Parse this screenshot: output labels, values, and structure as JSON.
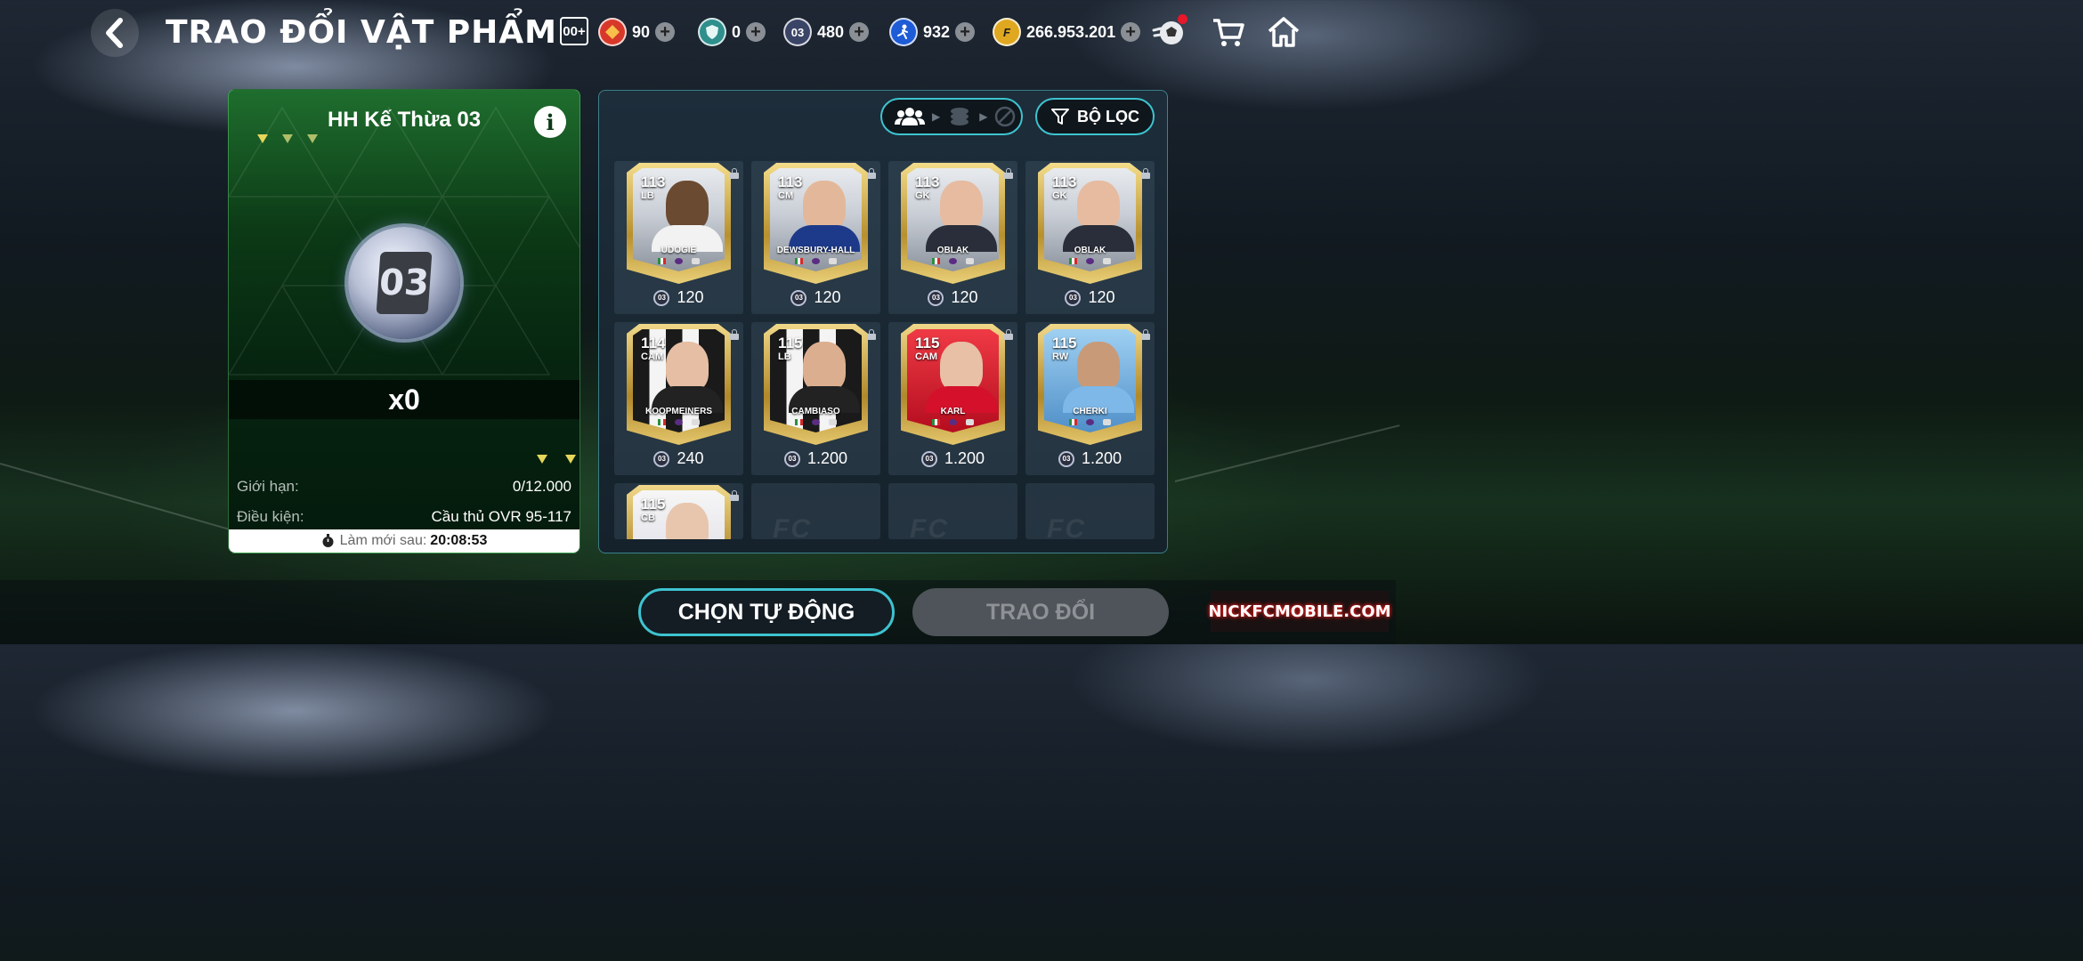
{
  "header": {
    "title": "TRAO ĐỔI VẬT PHẨM",
    "season_badge": "00+",
    "currencies": [
      {
        "name": "gem-red",
        "value": "90",
        "color": "#d8382a"
      },
      {
        "name": "shield",
        "value": "0",
        "color": "#2f8f8c"
      },
      {
        "name": "token-03",
        "value": "480",
        "icon_text": "03",
        "color": "#3a4466"
      },
      {
        "name": "player-icon",
        "value": "932",
        "color": "#1e5bd6"
      },
      {
        "name": "fc-coin",
        "value": "266.953.201",
        "color": "#e0a820"
      }
    ]
  },
  "left_panel": {
    "title": "HH Kế Thừa 03",
    "token_label": "03",
    "quantity": "x0",
    "limit_label": "Giới hạn:",
    "limit_value": "0/12.000",
    "condition_label": "Điều kiện:",
    "condition_value": "Cầu thủ OVR 95-117",
    "refresh_label": "Làm mới sau:",
    "refresh_time": "20:08:53"
  },
  "right_panel": {
    "filter_label": "BỘ LỌC",
    "players": [
      {
        "ovr": "113",
        "pos": "LB",
        "name": "UDOGIE",
        "price": "120",
        "theme": "gold",
        "skin": "#6b4a32",
        "shirt": "#f2f2f2"
      },
      {
        "ovr": "113",
        "pos": "CM",
        "name": "DEWSBURY-HALL",
        "price": "120",
        "theme": "gold",
        "skin": "#e3b89a",
        "shirt": "#1d3a8a"
      },
      {
        "ovr": "113",
        "pos": "GK",
        "name": "OBLAK",
        "price": "120",
        "theme": "gold",
        "skin": "#e6bba0",
        "shirt": "#2a2e3a"
      },
      {
        "ovr": "113",
        "pos": "GK",
        "name": "OBLAK",
        "price": "120",
        "theme": "gold",
        "skin": "#e6bba0",
        "shirt": "#2a2e3a"
      },
      {
        "ovr": "114",
        "pos": "CAM",
        "name": "KOOPMEINERS",
        "price": "240",
        "theme": "juve",
        "skin": "#e6bea3",
        "shirt": "#222222"
      },
      {
        "ovr": "115",
        "pos": "LB",
        "name": "CAMBIASO",
        "price": "1.200",
        "theme": "juve",
        "skin": "#dcae90",
        "shirt": "#222222"
      },
      {
        "ovr": "115",
        "pos": "CAM",
        "name": "KARL",
        "price": "1.200",
        "theme": "bayern",
        "skin": "#e8c0a5",
        "shirt": "#d4102a"
      },
      {
        "ovr": "115",
        "pos": "RW",
        "name": "CHERKI",
        "price": "1.200",
        "theme": "city",
        "skin": "#c89a78",
        "shirt": "#7db8e8"
      },
      {
        "ovr": "115",
        "pos": "CB",
        "name": "",
        "price": "",
        "theme": "real",
        "skin": "#e8c6ae",
        "shirt": "#f4f4f4"
      }
    ],
    "empty_slots": 3
  },
  "buttons": {
    "auto_select": "CHỌN TỰ ĐỘNG",
    "trade": "TRAO ĐỔI"
  },
  "watermark": "NICKFCMOBILE.COM",
  "colors": {
    "accent": "#3ec3d0",
    "gold_card": "#d8b34a",
    "panel_green": "#0c3a16"
  }
}
